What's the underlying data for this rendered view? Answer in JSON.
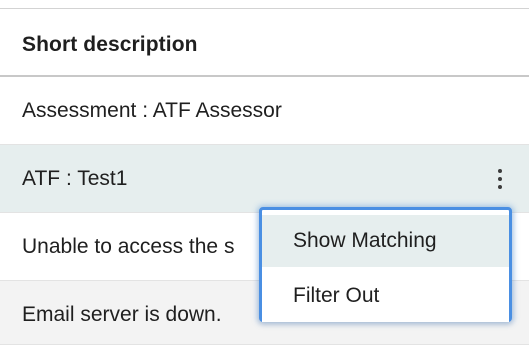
{
  "table": {
    "header": "Short description",
    "rows": [
      {
        "text": "Assessment : ATF Assessor"
      },
      {
        "text": "ATF : Test1"
      },
      {
        "text": "Unable to access the s"
      },
      {
        "text": "Email server is down."
      }
    ]
  },
  "context_menu": {
    "items": [
      {
        "label": "Show Matching"
      },
      {
        "label": "Filter Out"
      }
    ]
  },
  "icons": {
    "row_menu": "more-vertical-icon"
  },
  "colors": {
    "selected_row": "#e6eeee",
    "focus_ring": "#4a8fe3"
  }
}
